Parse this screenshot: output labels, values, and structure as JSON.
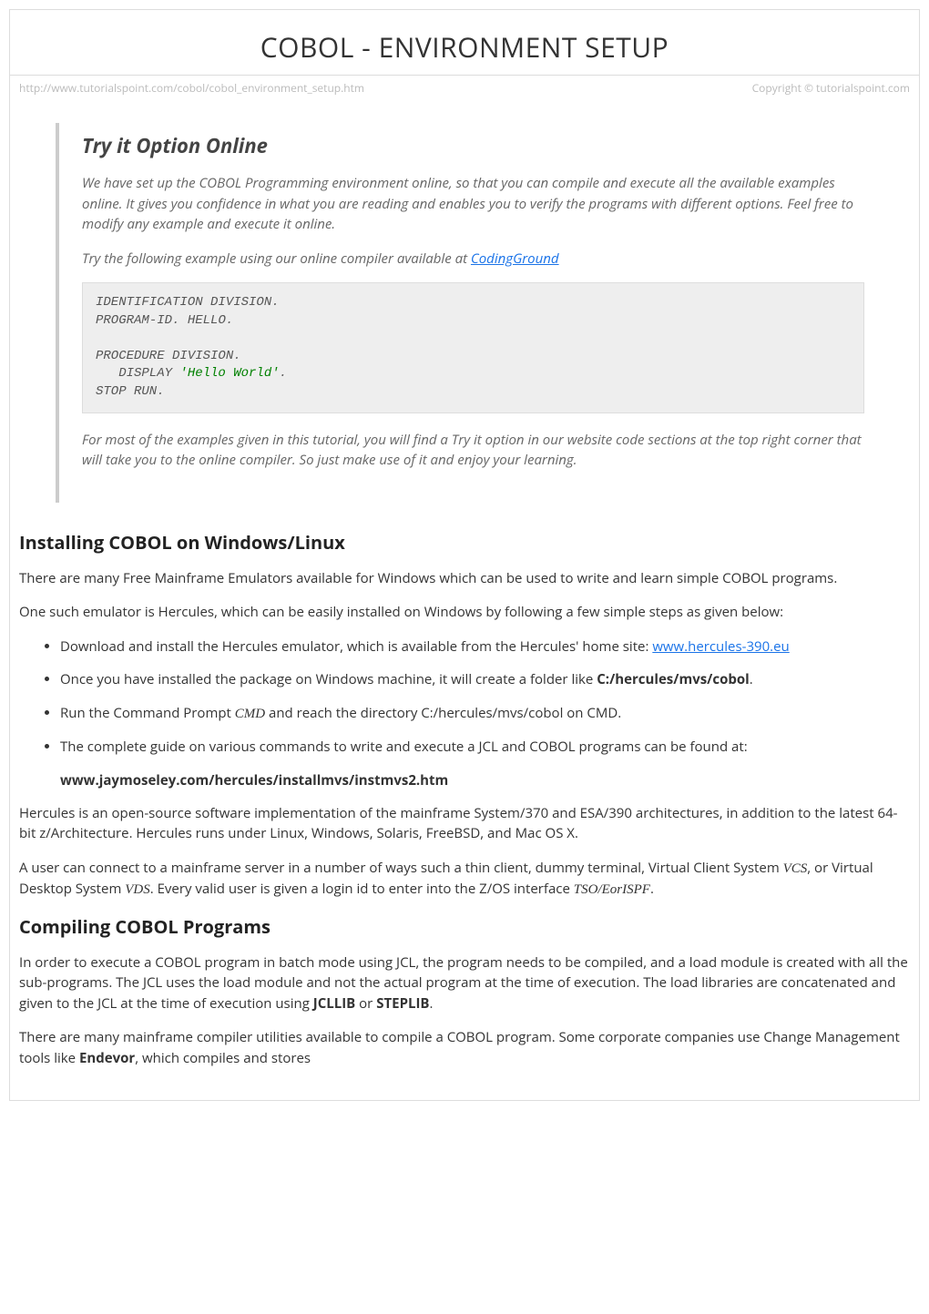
{
  "header": {
    "title": "COBOL - ENVIRONMENT SETUP",
    "url": "http://www.tutorialspoint.com/cobol/cobol_environment_setup.htm",
    "copyright": "Copyright © tutorialspoint.com"
  },
  "callout": {
    "heading": "Try it Option Online",
    "para1": "We have set up the COBOL Programming environment online, so that you can compile and execute all the available examples online. It gives you confidence in what you are reading and enables you to verify the programs with different options. Feel free to modify any example and execute it online.",
    "para2_prefix": "Try the following example using our online compiler available at ",
    "para2_link": "CodingGround",
    "code": {
      "l1": "IDENTIFICATION DIVISION",
      "l2a": "PROGRAM",
      "l2b": "ID",
      "l2c": " HELLO",
      "l3": "PROCEDURE DIVISION",
      "l4": "   DISPLAY ",
      "l4str": "'Hello World'",
      "l5": "STOP RUN"
    },
    "para3": "For most of the examples given in this tutorial, you will find a Try it option in our website code sections at the top right corner that will take you to the online compiler. So just make use of it and enjoy your learning."
  },
  "install": {
    "heading": "Installing COBOL on Windows/Linux",
    "p1": "There are many Free Mainframe Emulators available for Windows which can be used to write and learn simple COBOL programs.",
    "p2": "One such emulator is Hercules, which can be easily installed on Windows by following a few simple steps as given below:",
    "li1_prefix": "Download and install the Hercules emulator, which is available from the Hercules' home site: ",
    "li1_link": "www.hercules-390.eu",
    "li2_prefix": "Once you have installed the package on Windows machine, it will create a folder like ",
    "li2_bold": "C:/hercules/mvs/cobol",
    "li3_a": "Run the Command Prompt ",
    "li3_em": "CMD",
    "li3_b": " and reach the directory C:/hercules/mvs/cobol on CMD.",
    "li4": "The complete guide on various commands to write and execute a JCL and COBOL programs can be found at:",
    "li4_url": "www.jaymoseley.com/hercules/installmvs/instmvs2.htm",
    "p3": "Hercules is an open-source software implementation of the mainframe System/370 and ESA/390 architectures, in addition to the latest 64-bit z/Architecture. Hercules runs under Linux, Windows, Solaris, FreeBSD, and Mac OS X.",
    "p4_a": "A user can connect to a mainframe server in a number of ways such a thin client, dummy terminal, Virtual Client System ",
    "p4_em1": "VCS",
    "p4_b": ", or Virtual Desktop System ",
    "p4_em2": "VDS",
    "p4_c": ". Every valid user is given a login id to enter into the Z/OS interface ",
    "p4_em3": "TSO/EorISPF",
    "p4_d": "."
  },
  "compile": {
    "heading": "Compiling COBOL Programs",
    "p1_a": "In order to execute a COBOL program in batch mode using JCL, the program needs to be compiled, and a load module is created with all the sub-programs. The JCL uses the load module and not the actual program at the time of execution. The load libraries are concatenated and given to the JCL at the time of execution using ",
    "p1_b1": "JCLLIB",
    "p1_b": " or ",
    "p1_b2": "STEPLIB",
    "p1_c": ".",
    "p2_a": "There are many mainframe compiler utilities available to compile a COBOL program. Some corporate companies use Change Management tools like ",
    "p2_b": "Endevor",
    "p2_c": ", which compiles and stores"
  }
}
